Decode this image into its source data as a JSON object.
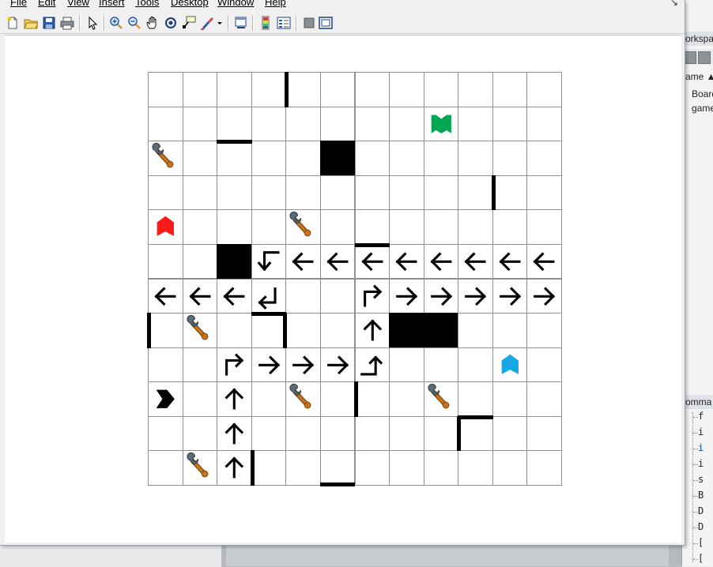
{
  "menu": {
    "file": "File",
    "edit": "Edit",
    "view": "View",
    "insert": "Insert",
    "tools": "Tools",
    "desktop": "Desktop",
    "window": "Window",
    "help": "Help"
  },
  "toolbar": {
    "buttons": [
      "new-figure",
      "open-file",
      "save-figure",
      "print-figure",
      "edit-plot",
      "zoom-in",
      "zoom-out",
      "pan",
      "rotate-3d",
      "data-cursor",
      "brush",
      "link-plot",
      "insert-colorbar",
      "insert-legend",
      "hide-plot-tools",
      "show-plot-tools"
    ]
  },
  "workspace": {
    "tab_label": "orkspa",
    "column_header": "ame",
    "items": [
      "Board",
      "game"
    ]
  },
  "command_history": {
    "tab_label": "omma",
    "lines": [
      "f",
      "i",
      "i",
      "i",
      "s",
      "B",
      "D",
      "D",
      "[",
      "["
    ]
  },
  "board": {
    "rows": 12,
    "cols": 12,
    "grid": [
      [
        ".",
        ".",
        ".",
        ".",
        ".",
        ".",
        ".",
        ".",
        ".",
        ".",
        ".",
        "."
      ],
      [
        ".",
        ".",
        ".",
        ".",
        ".",
        ".",
        ".",
        ".",
        "F_green",
        ".",
        ".",
        "."
      ],
      [
        "WR",
        ".",
        ".",
        ".",
        ".",
        "PIT",
        ".",
        ".",
        ".",
        ".",
        ".",
        "."
      ],
      [
        ".",
        ".",
        ".",
        ".",
        ".",
        ".",
        ".",
        ".",
        ".",
        ".",
        ".",
        "."
      ],
      [
        "F_red",
        ".",
        ".",
        ".",
        "WR",
        ".",
        ".",
        ".",
        ".",
        ".",
        ".",
        "."
      ],
      [
        ".",
        ".",
        "PIT",
        "TURN_DL",
        "L",
        "L",
        "L",
        "L",
        "L",
        "L",
        "L",
        "L"
      ],
      [
        "L",
        "L",
        "L",
        "TURN_UL",
        ".",
        ".",
        "TURN_UR",
        "R",
        "R",
        "R",
        "R",
        "R"
      ],
      [
        ".",
        "WR",
        ".",
        ".",
        ".",
        ".",
        "U",
        "PIT",
        "PIT",
        ".",
        ".",
        "."
      ],
      [
        ".",
        ".",
        "TURN_UR",
        "R",
        "R",
        "R",
        "TURN_RU",
        ".",
        ".",
        ".",
        "F_blue",
        "."
      ],
      [
        "F_black",
        ".",
        "U",
        ".",
        "WR",
        ".",
        ".",
        ".",
        "WR",
        ".",
        ".",
        "."
      ],
      [
        ".",
        ".",
        "U",
        ".",
        ".",
        ".",
        ".",
        ".",
        ".",
        ".",
        ".",
        "."
      ],
      [
        ".",
        "WR",
        "U",
        ".",
        ".",
        ".",
        ".",
        ".",
        ".",
        ".",
        ".",
        "."
      ]
    ],
    "walls": [
      {
        "row": 0,
        "col": 4,
        "side": "left"
      },
      {
        "row": 2,
        "col": 2,
        "side": "top"
      },
      {
        "row": 3,
        "col": 10,
        "side": "left"
      },
      {
        "row": 5,
        "col": 6,
        "side": "top"
      },
      {
        "row": 7,
        "col": 0,
        "side": "left"
      },
      {
        "row": 7,
        "col": 3,
        "side": "top"
      },
      {
        "row": 7,
        "col": 3,
        "side": "right"
      },
      {
        "row": 9,
        "col": 6,
        "side": "left"
      },
      {
        "row": 10,
        "col": 9,
        "side": "top"
      },
      {
        "row": 10,
        "col": 9,
        "side": "left"
      },
      {
        "row": 11,
        "col": 3,
        "side": "left"
      },
      {
        "row": 11,
        "col": 5,
        "side": "bottom"
      }
    ],
    "colors": {
      "flag_green": "#00a651",
      "flag_red": "#ff1a1a",
      "flag_blue": "#14a9e6",
      "flag_black": "#000000",
      "wrench": "#c9741a",
      "pit": "#000000",
      "arrow": "#000000"
    }
  }
}
